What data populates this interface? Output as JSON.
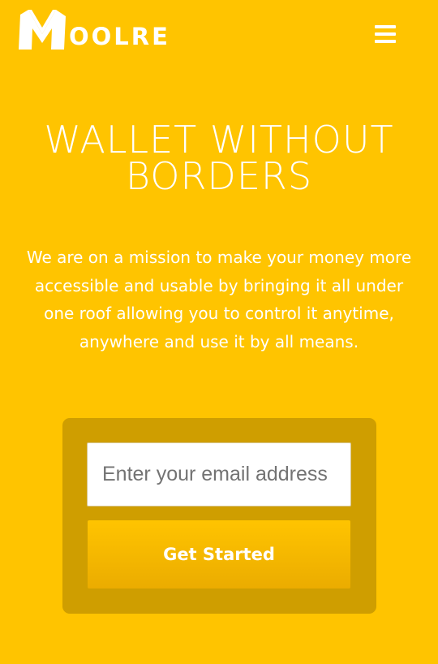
{
  "brand": {
    "logo_text": "OOLRE",
    "logo_icon": "moolre-m-logo-icon"
  },
  "header": {
    "menu_icon": "hamburger-menu-icon"
  },
  "hero": {
    "title": "WALLET WITHOUT BORDERS",
    "subtitle": "We are on a mission to make your money more accessible and usable by bringing it all under one roof allowing you to control it anytime, anywhere and use it by all means."
  },
  "signup": {
    "email_value": "",
    "email_placeholder": "Enter your email address",
    "button_label": "Get Started"
  },
  "colors": {
    "page_background": "#FFC400",
    "card_background": "#CF9E00",
    "button_top": "#FFC400",
    "button_bottom": "#EBAC00",
    "text": "#FFFFFF"
  }
}
